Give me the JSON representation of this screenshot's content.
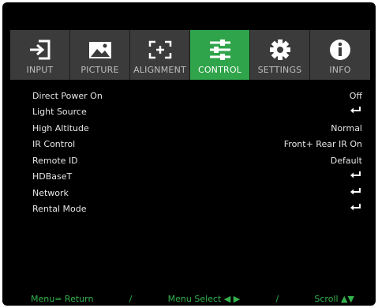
{
  "tabs": [
    {
      "label": "INPUT",
      "icon": "input-icon",
      "active": false
    },
    {
      "label": "PICTURE",
      "icon": "picture-icon",
      "active": false
    },
    {
      "label": "ALIGNMENT",
      "icon": "alignment-icon",
      "active": false
    },
    {
      "label": "CONTROL",
      "icon": "control-sliders-icon",
      "active": true
    },
    {
      "label": "SETTINGS",
      "icon": "gear-icon",
      "active": false
    },
    {
      "label": "INFO",
      "icon": "info-icon",
      "active": false
    }
  ],
  "menu": [
    {
      "label": "Direct Power On",
      "value": "Off"
    },
    {
      "label": "Light Source",
      "value": "",
      "icon": "enter-icon"
    },
    {
      "label": "High Altitude",
      "value": "Normal"
    },
    {
      "label": "IR Control",
      "value": "Front+ Rear IR On"
    },
    {
      "label": "Remote ID",
      "value": "Default"
    },
    {
      "label": "HDBaseT",
      "value": "",
      "icon": "enter-icon"
    },
    {
      "label": "Network",
      "value": "",
      "icon": "enter-icon"
    },
    {
      "label": "Rental Mode",
      "value": "",
      "icon": "enter-icon"
    }
  ],
  "footer": {
    "menu_return": "Menu= Return",
    "sep1": "/",
    "menu_select": "Menu Select ◀ ▶",
    "sep2": "/",
    "scroll": "Scroll ▲▼"
  },
  "colors": {
    "accent": "#2fa44a",
    "footer": "#33b24d",
    "background": "#000000",
    "tab_bg": "#3b3b3b"
  }
}
